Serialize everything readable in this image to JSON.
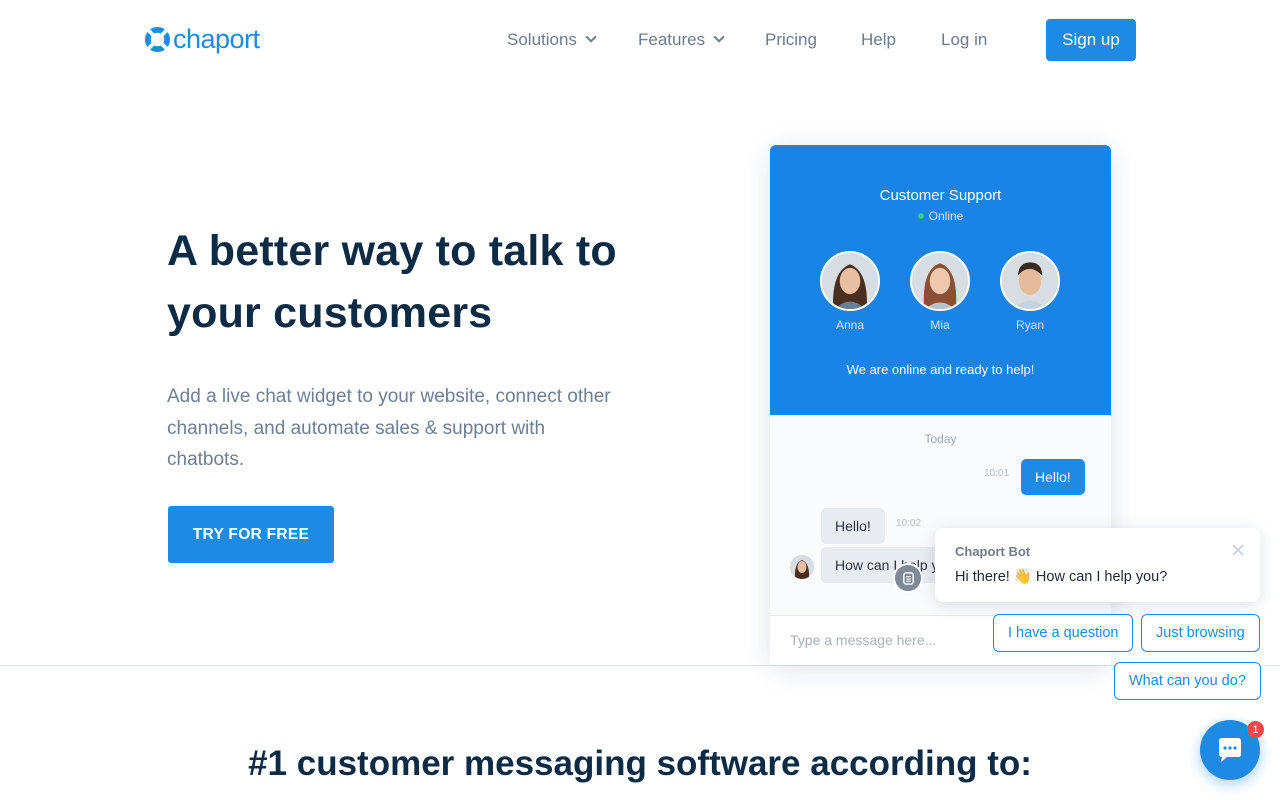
{
  "brand": {
    "name": "chaport",
    "color": "#1f8ae3"
  },
  "nav": {
    "items": [
      {
        "label": "Solutions",
        "dropdown": true
      },
      {
        "label": "Features",
        "dropdown": true
      },
      {
        "label": "Pricing",
        "dropdown": false
      },
      {
        "label": "Help",
        "dropdown": false
      },
      {
        "label": "Log in",
        "dropdown": false
      }
    ],
    "signup_label": "Sign up"
  },
  "hero": {
    "title": "A better way to talk to your customers",
    "subtitle": "Add a live chat widget to your website, connect other channels, and automate sales & support with chatbots.",
    "cta_label": "TRY FOR FREE"
  },
  "widget": {
    "team_name": "Customer Support",
    "status": "Online",
    "agents": [
      {
        "name": "Anna"
      },
      {
        "name": "Mia"
      },
      {
        "name": "Ryan"
      }
    ],
    "ready_text": "We are online and ready to help!",
    "day_label": "Today",
    "messages": [
      {
        "from": "visitor",
        "time": "10:01",
        "text": "Hello!"
      },
      {
        "from": "agent",
        "time": "10:02",
        "text": "Hello!"
      },
      {
        "from": "agent",
        "time": "",
        "text": "How can I help y"
      }
    ],
    "input_placeholder": "Type a message here..."
  },
  "bot": {
    "name": "Chaport Bot",
    "message": "Hi there! 👋 How can I help you?",
    "quick_replies": [
      "I have a question",
      "Just browsing",
      "What can you do?"
    ]
  },
  "launcher": {
    "unread_count": "1"
  },
  "section_title": "#1 customer messaging software according to:"
}
